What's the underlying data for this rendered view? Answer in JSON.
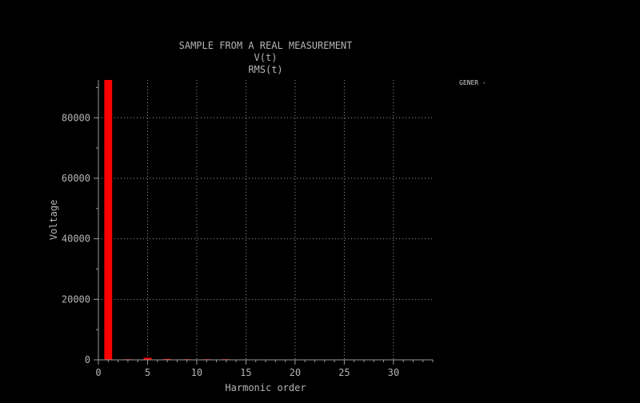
{
  "chart_data": {
    "type": "bar",
    "title_lines": [
      "SAMPLE FROM A REAL MEASUREMENT",
      "V(t)",
      "RMS(t)"
    ],
    "xlabel": "Harmonic order",
    "ylabel": "Voltage",
    "xlim": [
      0,
      34
    ],
    "ylim": [
      0,
      92500
    ],
    "x_ticks": [
      0,
      5,
      10,
      15,
      20,
      25,
      30
    ],
    "y_ticks": [
      0,
      20000,
      40000,
      60000,
      80000
    ],
    "y_tick_labels": [
      "0",
      "20000",
      "40000",
      "60000",
      "80000"
    ],
    "grid": true,
    "bar_color": "#ff0000",
    "series": [
      {
        "legend_label": "GENER -",
        "x": [
          1,
          3,
          5,
          7,
          9,
          11,
          13
        ],
        "values": [
          92500,
          150,
          700,
          300,
          120,
          150,
          60
        ]
      }
    ]
  }
}
